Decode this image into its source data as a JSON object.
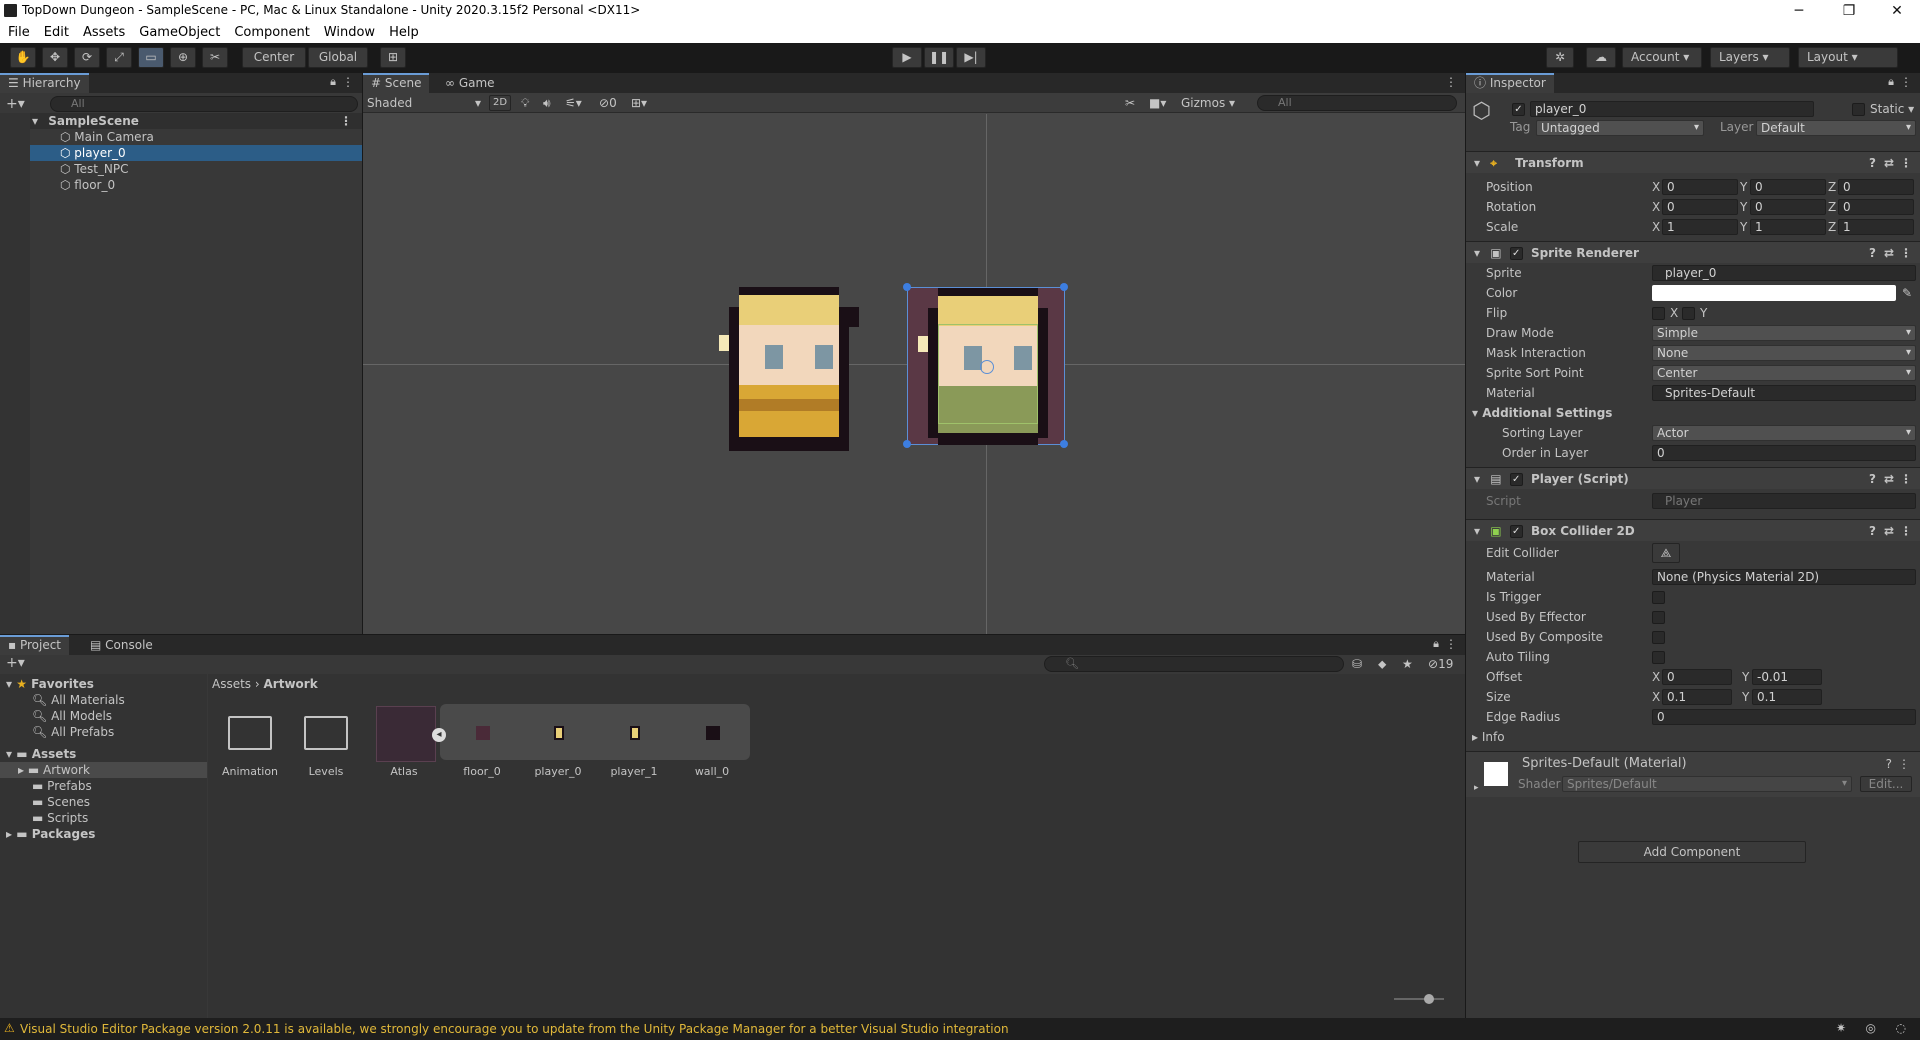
{
  "window": {
    "title": "TopDown Dungeon - SampleScene - PC, Mac & Linux Standalone - Unity 2020.3.15f2 Personal <DX11>",
    "minimize": "─",
    "maximize": "❐",
    "close": "✕"
  },
  "menu": [
    "File",
    "Edit",
    "Assets",
    "GameObject",
    "Component",
    "Window",
    "Help"
  ],
  "toolbar": {
    "center": "Center",
    "global": "Global",
    "account": "Account",
    "layers": "Layers",
    "layout": "Layout"
  },
  "hierarchy": {
    "tab": "Hierarchy",
    "search_placeholder": "All",
    "scene": "SampleScene",
    "items": [
      "Main Camera",
      "player_0",
      "Test_NPC",
      "floor_0"
    ],
    "selected": "player_0"
  },
  "scene": {
    "tabs": [
      "Scene",
      "Game"
    ],
    "shading": "Shaded",
    "mode_2d": "2D",
    "hidden_count": "0",
    "gizmos": "Gizmos",
    "search_placeholder": "All"
  },
  "project": {
    "tabs": [
      "Project",
      "Console"
    ],
    "favorites": {
      "label": "Favorites",
      "items": [
        "All Materials",
        "All Models",
        "All Prefabs"
      ]
    },
    "assets": {
      "label": "Assets",
      "items": [
        "Artwork",
        "Prefabs",
        "Scenes",
        "Scripts"
      ]
    },
    "packages": "Packages",
    "breadcrumb": [
      "Assets",
      "Artwork"
    ],
    "files": [
      "Animation",
      "Levels",
      "Atlas",
      "floor_0",
      "player_0",
      "player_1",
      "wall_0"
    ],
    "hidden_count": "19"
  },
  "inspector": {
    "tab": "Inspector",
    "object_name": "player_0",
    "static": "Static",
    "tag_label": "Tag",
    "tag": "Untagged",
    "layer_label": "Layer",
    "layer": "Default",
    "transform": {
      "title": "Transform",
      "rows": [
        {
          "label": "Position",
          "x": "0",
          "y": "0",
          "z": "0"
        },
        {
          "label": "Rotation",
          "x": "0",
          "y": "0",
          "z": "0"
        },
        {
          "label": "Scale",
          "x": "1",
          "y": "1",
          "z": "1"
        }
      ]
    },
    "sprite_renderer": {
      "title": "Sprite Renderer",
      "sprite_label": "Sprite",
      "sprite": "player_0",
      "color_label": "Color",
      "flip_label": "Flip",
      "flip_x": "X",
      "flip_y": "Y",
      "draw_mode_label": "Draw Mode",
      "draw_mode": "Simple",
      "mask_label": "Mask Interaction",
      "mask": "None",
      "sort_point_label": "Sprite Sort Point",
      "sort_point": "Center",
      "material_label": "Material",
      "material": "Sprites-Default",
      "additional": "Additional Settings",
      "sorting_layer_label": "Sorting Layer",
      "sorting_layer": "Actor",
      "order_label": "Order in Layer",
      "order": "0"
    },
    "player_script": {
      "title": "Player (Script)",
      "script_label": "Script",
      "script": "Player"
    },
    "box_collider": {
      "title": "Box Collider 2D",
      "edit_label": "Edit Collider",
      "material_label": "Material",
      "material": "None (Physics Material 2D)",
      "is_trigger": "Is Trigger",
      "used_by_effector": "Used By Effector",
      "used_by_composite": "Used By Composite",
      "auto_tiling": "Auto Tiling",
      "offset_label": "Offset",
      "offset_x": "0",
      "offset_y": "-0.01",
      "size_label": "Size",
      "size_x": "0.1",
      "size_y": "0.1",
      "edge_label": "Edge Radius",
      "edge": "0",
      "info": "Info"
    },
    "material_block": {
      "title": "Sprites-Default (Material)",
      "shader_label": "Shader",
      "shader": "Sprites/Default",
      "edit": "Edit..."
    },
    "add_component": "Add Component"
  },
  "status": {
    "message": "Visual Studio Editor Package version 2.0.11 is available, we strongly encourage you to update from the Unity Package Manager for a better Visual Studio integration"
  }
}
